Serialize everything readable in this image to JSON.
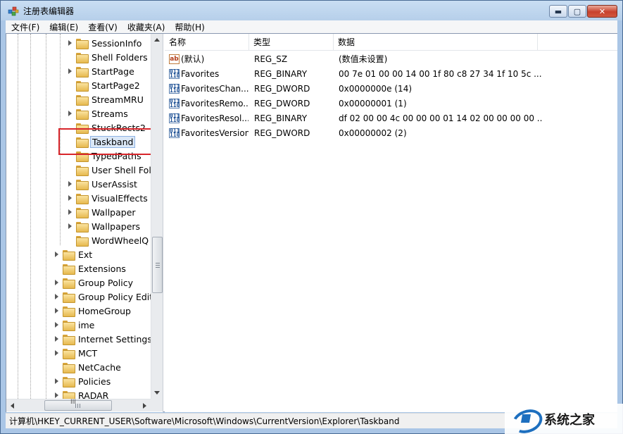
{
  "window": {
    "title": "注册表编辑器",
    "minimize_glyph": "▬",
    "maximize_glyph": "▢",
    "close_glyph": "✕"
  },
  "menu": [
    "文件(F)",
    "编辑(E)",
    "查看(V)",
    "收藏夹(A)",
    "帮助(H)"
  ],
  "tree": {
    "children": [
      {
        "label": "SessionInfo",
        "expandable": true
      },
      {
        "label": "Shell Folders",
        "expandable": false
      },
      {
        "label": "StartPage",
        "expandable": true
      },
      {
        "label": "StartPage2",
        "expandable": false
      },
      {
        "label": "StreamMRU",
        "expandable": false
      },
      {
        "label": "Streams",
        "expandable": true
      },
      {
        "label": "StuckRects2",
        "expandable": false
      },
      {
        "label": "Taskband",
        "expandable": false,
        "selected": true
      },
      {
        "label": "TypedPaths",
        "expandable": false
      },
      {
        "label": "User Shell Fol",
        "expandable": false
      },
      {
        "label": "UserAssist",
        "expandable": true
      },
      {
        "label": "VisualEffects",
        "expandable": true
      },
      {
        "label": "Wallpaper",
        "expandable": true
      },
      {
        "label": "Wallpapers",
        "expandable": true
      },
      {
        "label": "WordWheelQ",
        "expandable": false
      }
    ],
    "siblings": [
      {
        "label": "Ext",
        "expandable": true
      },
      {
        "label": "Extensions",
        "expandable": false
      },
      {
        "label": "Group Policy",
        "expandable": true
      },
      {
        "label": "Group Policy Edit",
        "expandable": true
      },
      {
        "label": "HomeGroup",
        "expandable": true
      },
      {
        "label": "ime",
        "expandable": true
      },
      {
        "label": "Internet Settings",
        "expandable": true
      },
      {
        "label": "MCT",
        "expandable": true
      },
      {
        "label": "NetCache",
        "expandable": false
      },
      {
        "label": "Policies",
        "expandable": true
      },
      {
        "label": "RADAR",
        "expandable": true
      }
    ],
    "hscroll_grip": "III"
  },
  "list": {
    "columns": [
      "名称",
      "类型",
      "数据"
    ],
    "rows": [
      {
        "icon": "string-value-icon",
        "icon_text": "ab",
        "name": "(默认)",
        "type": "REG_SZ",
        "data": "(数值未设置)"
      },
      {
        "icon": "binary-value-icon",
        "icon_text": "011\n110",
        "name": "Favorites",
        "type": "REG_BINARY",
        "data": "00 7e 01 00 00 14 00 1f 80 c8 27 34 1f 10 5c ..."
      },
      {
        "icon": "binary-value-icon",
        "icon_text": "011\n110",
        "name": "FavoritesChan...",
        "type": "REG_DWORD",
        "data": "0x0000000e (14)"
      },
      {
        "icon": "binary-value-icon",
        "icon_text": "011\n110",
        "name": "FavoritesRemo...",
        "type": "REG_DWORD",
        "data": "0x00000001 (1)"
      },
      {
        "icon": "binary-value-icon",
        "icon_text": "011\n110",
        "name": "FavoritesResol...",
        "type": "REG_BINARY",
        "data": "df 02 00 00 4c 00 00 00 01 14 02 00 00 00 00 ..."
      },
      {
        "icon": "binary-value-icon",
        "icon_text": "011\n110",
        "name": "FavoritesVersion",
        "type": "REG_DWORD",
        "data": "0x00000002 (2)"
      }
    ]
  },
  "status": {
    "path": "计算机\\HKEY_CURRENT_USER\\Software\\Microsoft\\Windows\\CurrentVersion\\Explorer\\Taskband"
  },
  "watermark": {
    "text": "系统之家"
  }
}
